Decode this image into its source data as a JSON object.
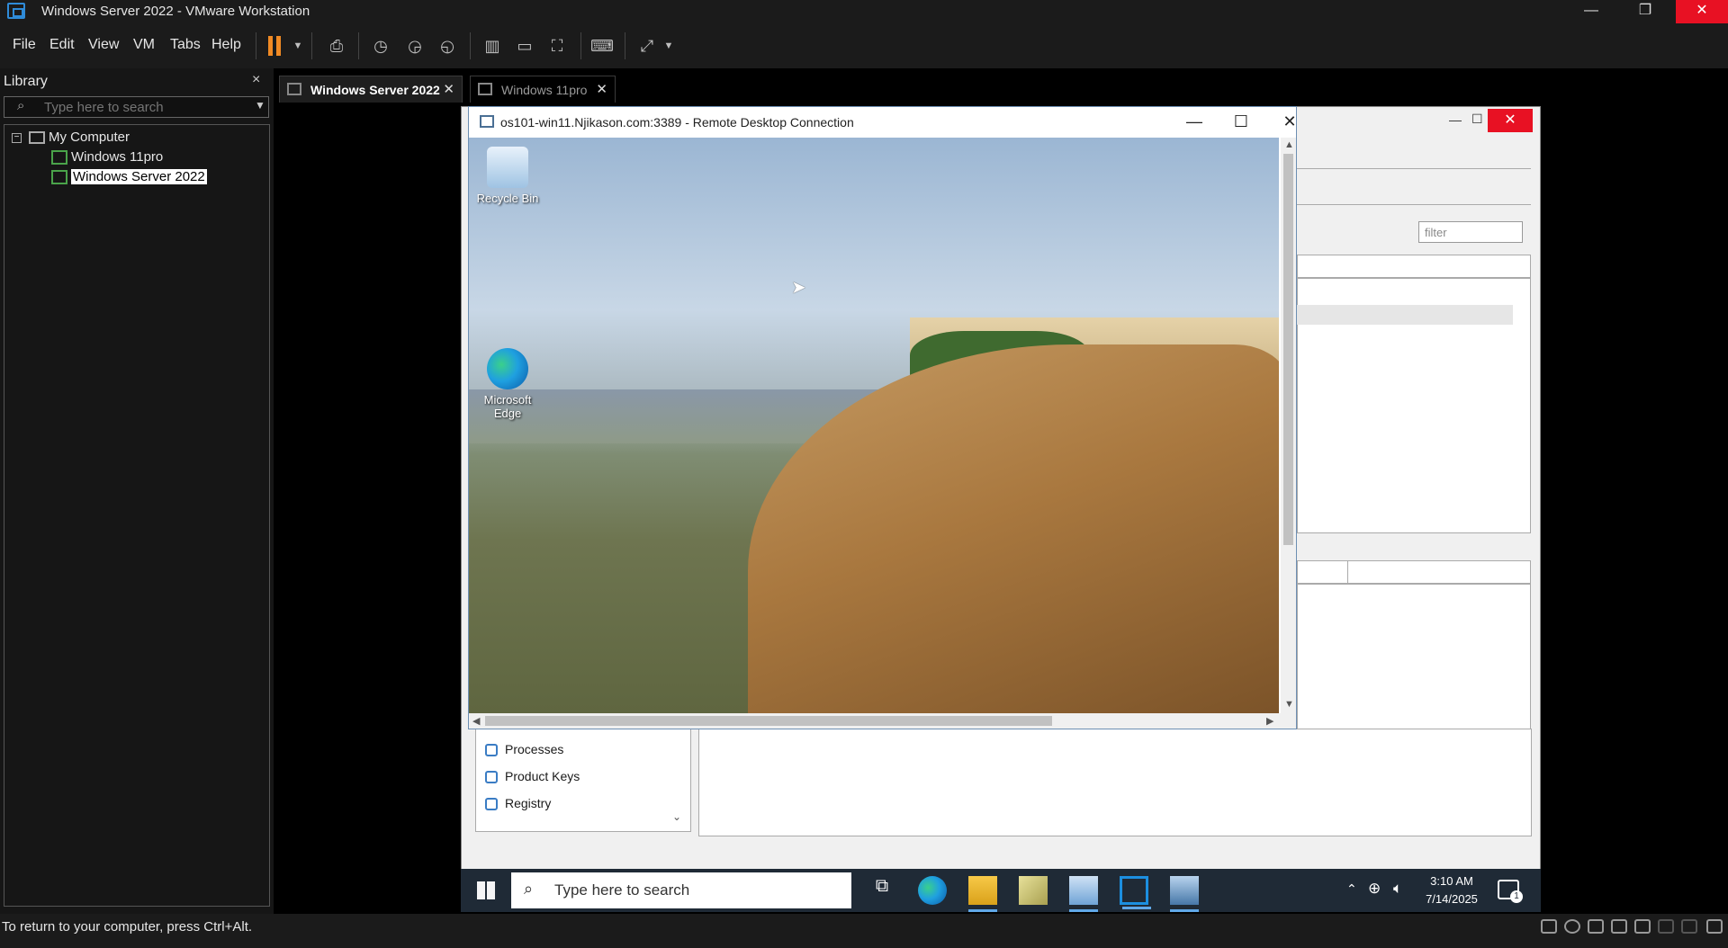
{
  "window": {
    "title": "Windows Server 2022 - VMware Workstation",
    "minimize_glyph": "—",
    "restore_glyph": "❐",
    "close_glyph": "✕"
  },
  "menubar": {
    "items": [
      "File",
      "Edit",
      "View",
      "VM",
      "Tabs",
      "Help"
    ]
  },
  "library": {
    "title": "Library",
    "close_glyph": "×",
    "search_placeholder": "Type here to search",
    "tree": {
      "root": "My Computer",
      "children": [
        "Windows 11pro",
        "Windows Server 2022"
      ]
    }
  },
  "tabs": [
    {
      "label": "Windows Server 2022",
      "active": true
    },
    {
      "label": "Windows 11pro",
      "active": false
    }
  ],
  "rdp": {
    "title": "os101-win11.Njikason.com:3389 - Remote Desktop Connection",
    "desktop_icons": [
      {
        "label": "Recycle Bin",
        "icon": "recycle-bin-icon"
      },
      {
        "label": "Microsoft Edge",
        "icon": "edge-icon"
      }
    ]
  },
  "server_manager": {
    "filter_placeholder": "filter",
    "nav_items": [
      "Processes",
      "Product Keys",
      "Registry"
    ]
  },
  "guest_taskbar": {
    "search_placeholder": "Type here to search",
    "time": "3:10 AM",
    "date": "7/14/2025",
    "notification_count": "1"
  },
  "statusbar": {
    "text": "To return to your computer, press Ctrl+Alt."
  },
  "colors": {
    "chrome_bg": "#1b1b1b",
    "close_red": "#e81123",
    "vm_green": "#4aa34a",
    "accent_blue": "#2f8bd8"
  }
}
